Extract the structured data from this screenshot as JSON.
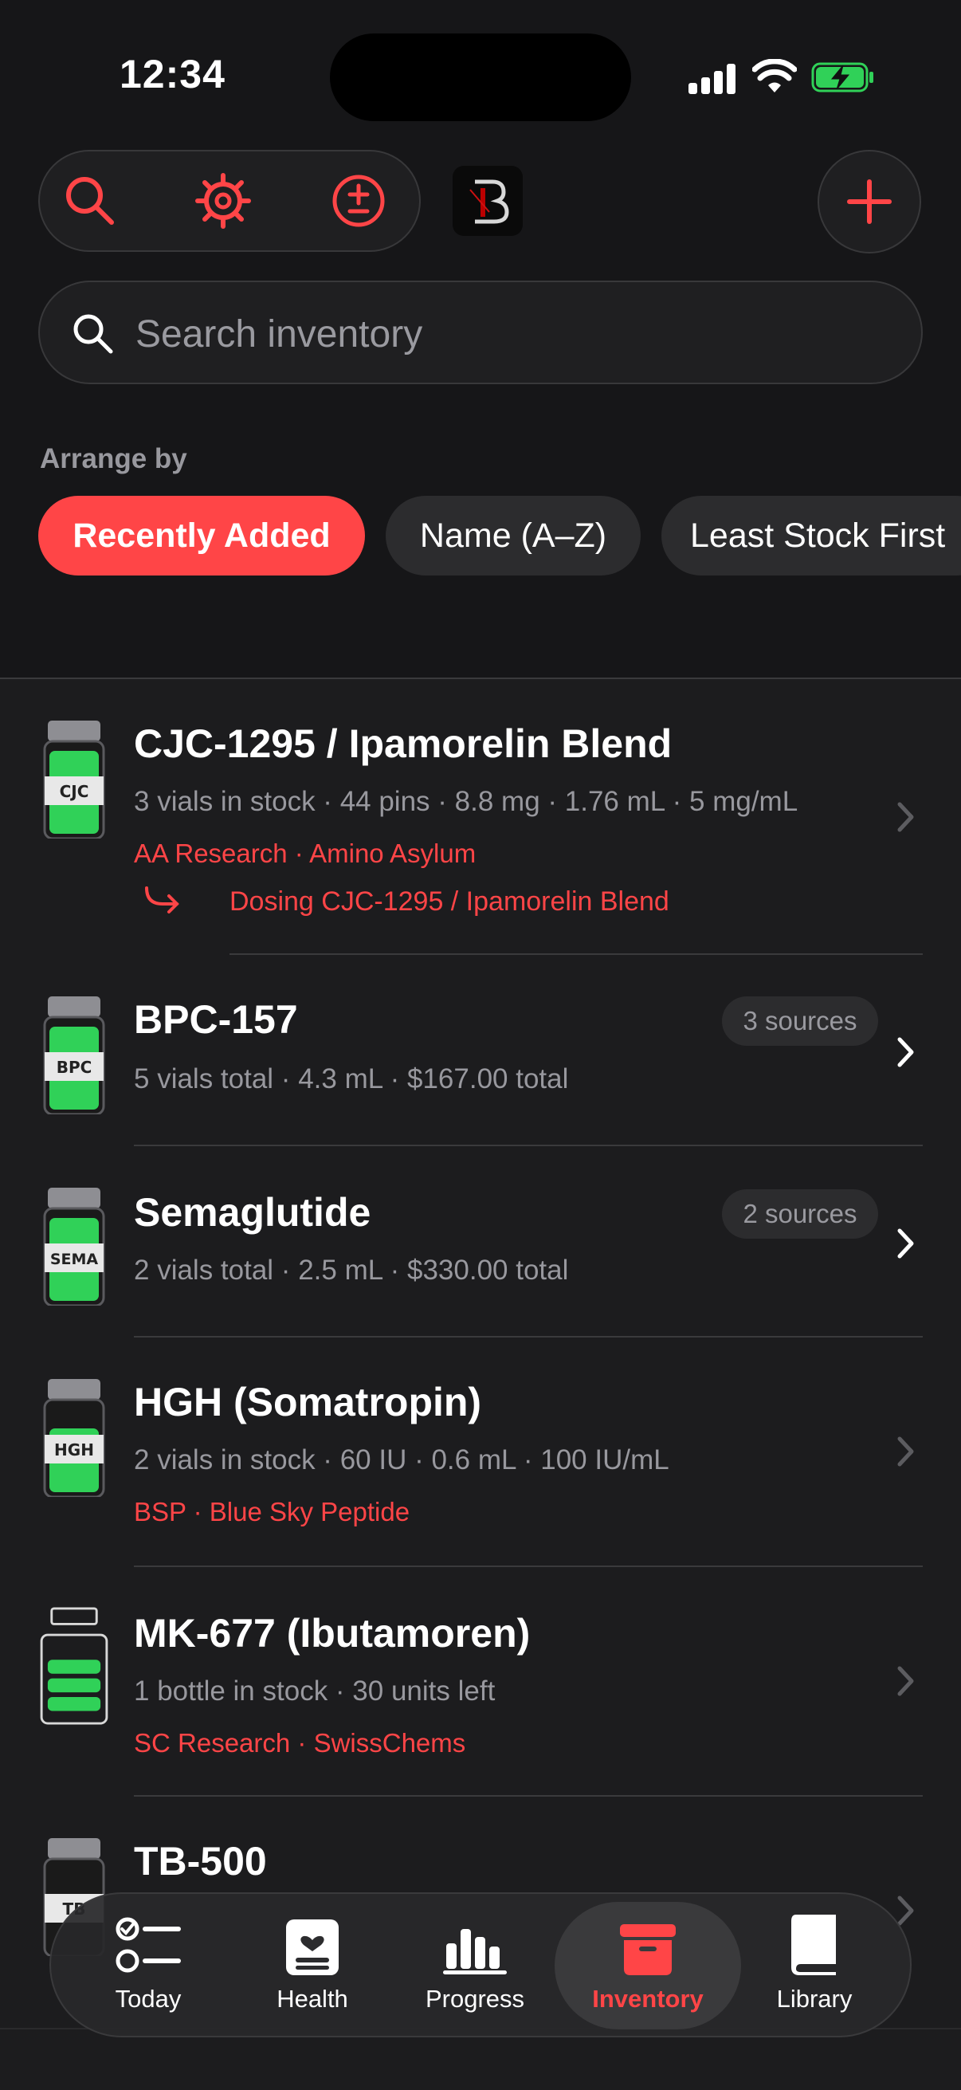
{
  "status": {
    "time": "12:34"
  },
  "search": {
    "placeholder": "Search inventory"
  },
  "arrange": {
    "label": "Arrange by",
    "options": [
      "Recently Added",
      "Name (A–Z)",
      "Least Stock First"
    ],
    "selected": "Recently Added"
  },
  "items": [
    {
      "vial_label": "CJC",
      "title": "CJC-1295 / Ipamorelin Blend",
      "subtitle": "3 vials in stock · 44 pins · 8.8 mg · 1.76 mL · 5 mg/mL",
      "vendor": "AA Research · Amino Asylum",
      "link": "Dosing CJC-1295 / Ipamorelin Blend"
    },
    {
      "vial_label": "BPC",
      "title": "BPC-157",
      "badge": "3 sources",
      "subtitle": "5 vials total · 4.3 mL · $167.00 total"
    },
    {
      "vial_label": "SEMA",
      "title": "Semaglutide",
      "badge": "2 sources",
      "subtitle": "2 vials total · 2.5 mL · $330.00 total"
    },
    {
      "vial_label": "HGH",
      "title": "HGH (Somatropin)",
      "subtitle": "2 vials in stock · 60 IU · 0.6 mL · 100 IU/mL",
      "vendor": "BSP · Blue Sky Peptide"
    },
    {
      "title": "MK-677 (Ibutamoren)",
      "subtitle": "1 bottle in stock · 30 units left",
      "vendor": "SC Research · SwissChems"
    },
    {
      "vial_label": "TB",
      "title": "TB-500"
    }
  ],
  "tabs": [
    "Today",
    "Health",
    "Progress",
    "Inventory",
    "Library"
  ],
  "active_tab": "Inventory",
  "colors": {
    "accent": "#ff4547",
    "vial_fill": "#30d158",
    "background": "#1c1c1e"
  }
}
